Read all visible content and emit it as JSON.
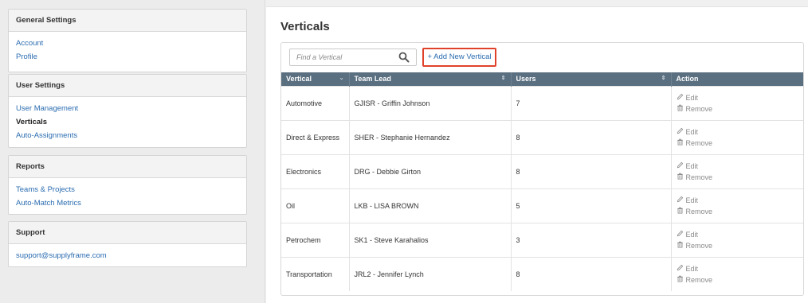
{
  "sidebar": {
    "panels": [
      {
        "title": "General Settings",
        "links": [
          "Account",
          "Profile"
        ]
      },
      {
        "title": "User Settings",
        "links": [
          "User Management",
          "Verticals",
          "Auto-Assignments"
        ]
      },
      {
        "title": "Reports",
        "links": [
          "Teams & Projects",
          "Auto-Match Metrics"
        ]
      },
      {
        "title": "Support",
        "links": [
          "support@supplyframe.com"
        ]
      }
    ]
  },
  "main": {
    "title": "Verticals",
    "search_placeholder": "Find a Vertical",
    "add_button": "+ Add New Vertical",
    "columns": [
      "Vertical",
      "Team Lead",
      "Users",
      "Action"
    ],
    "rows": [
      {
        "vertical": "Automotive",
        "lead": "GJISR - Griffin Johnson",
        "users": "7"
      },
      {
        "vertical": "Direct & Express",
        "lead": "SHER - Stephanie Hernandez",
        "users": "8"
      },
      {
        "vertical": "Electronics",
        "lead": "DRG - Debbie Girton",
        "users": "8"
      },
      {
        "vertical": "Oil",
        "lead": "LKB - LISA BROWN",
        "users": "5"
      },
      {
        "vertical": "Petrochem",
        "lead": "SK1 - Steve Karahalios",
        "users": "3"
      },
      {
        "vertical": "Transportation",
        "lead": "JRL2 - Jennifer Lynch",
        "users": "8"
      }
    ],
    "actions": {
      "edit": "Edit",
      "remove": "Remove"
    }
  }
}
